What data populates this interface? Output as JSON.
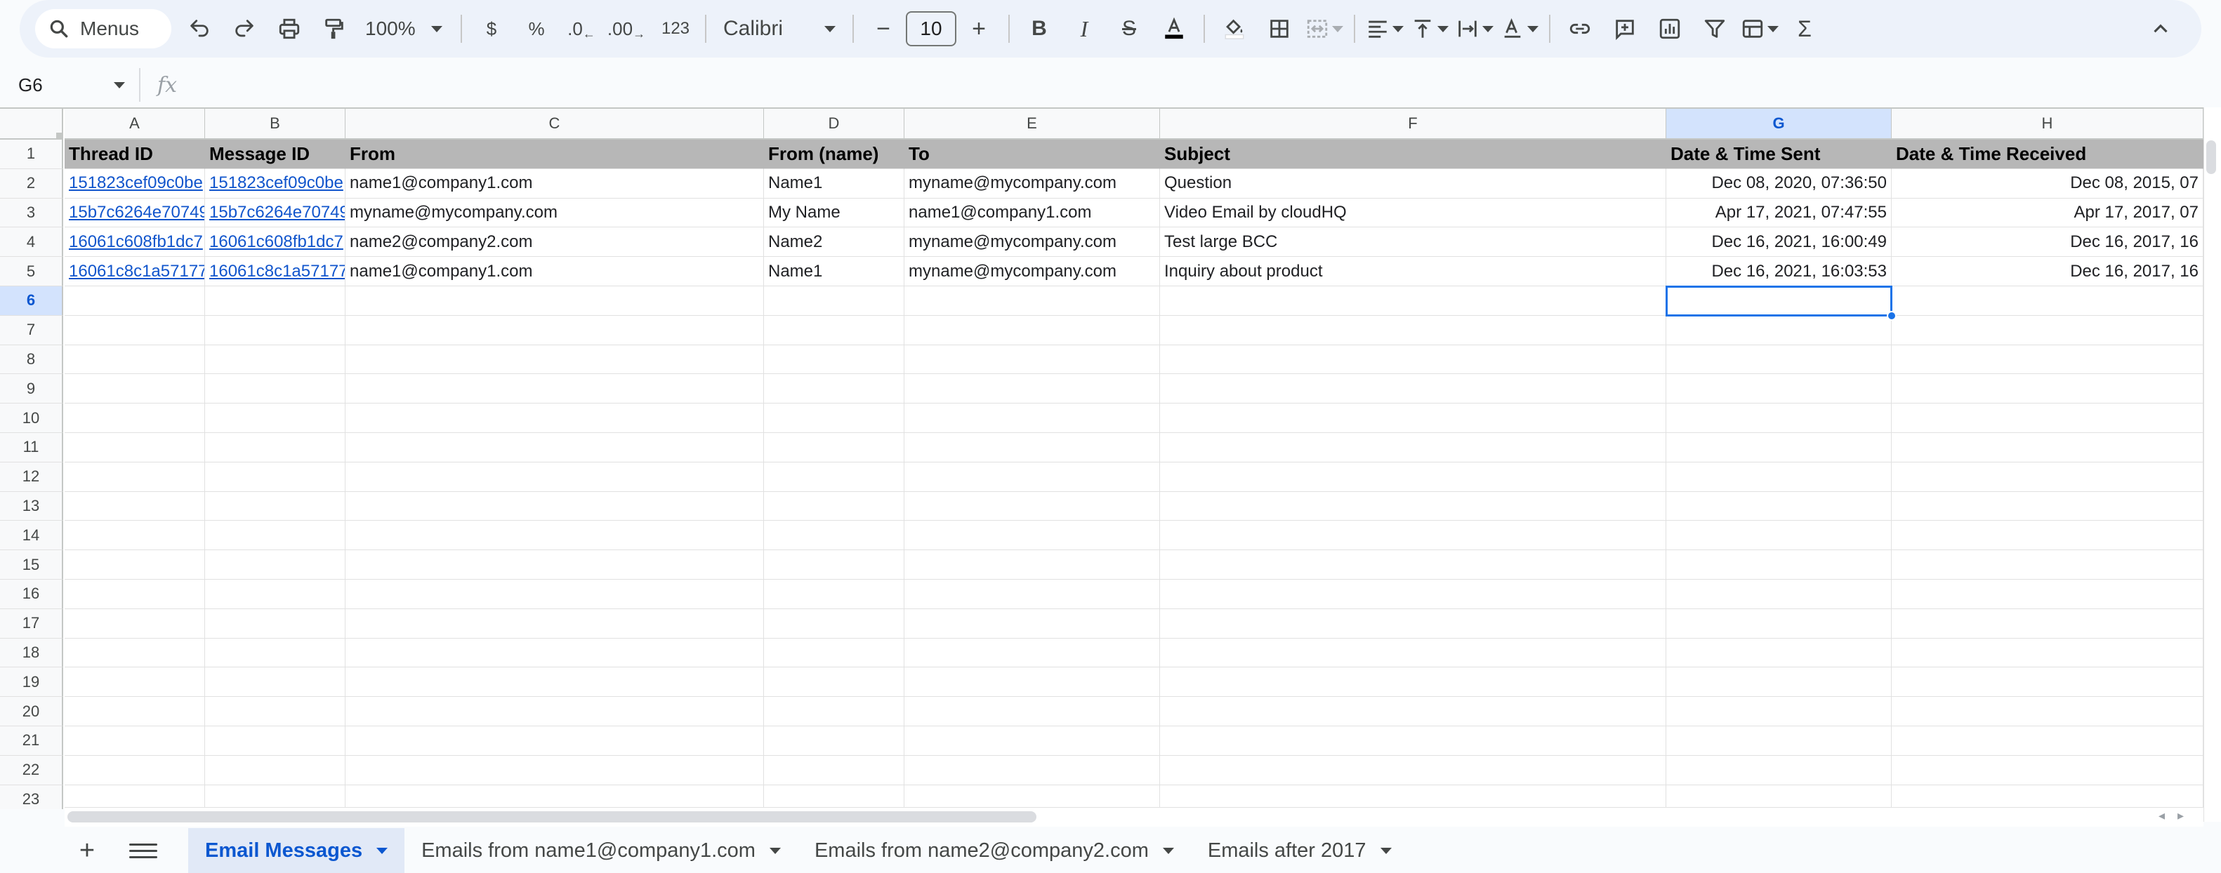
{
  "toolbar": {
    "search_label": "Menus",
    "zoom": "100%",
    "currency": "$",
    "percent": "%",
    "decrease_decimal": ".0",
    "increase_decimal": ".00",
    "number_format": "123",
    "font": "Calibri",
    "font_size": "10"
  },
  "formula_bar": {
    "cell_ref": "G6",
    "fx": "fx",
    "content": ""
  },
  "columns": [
    "A",
    "B",
    "C",
    "D",
    "E",
    "F",
    "G",
    "H"
  ],
  "selected_column": "G",
  "rows": [
    "1",
    "2",
    "3",
    "4",
    "5",
    "6",
    "7",
    "8",
    "9",
    "10",
    "11",
    "12",
    "13",
    "14",
    "15",
    "16",
    "17",
    "18",
    "19",
    "20",
    "21",
    "22",
    "23"
  ],
  "selected_row": "6",
  "headers": [
    "Thread ID",
    "Message ID",
    "From",
    "From (name)",
    "To",
    "Subject",
    "Date & Time Sent",
    "Date & Time Received"
  ],
  "data_rows": [
    [
      "151823cef09c0be",
      "151823cef09c0be",
      "name1@company1.com",
      "Name1",
      "myname@mycompany.com",
      "Question",
      "Dec 08, 2020, 07:36:50",
      "Dec 08, 2015, 07"
    ],
    [
      "15b7c6264e70749",
      "15b7c6264e70749",
      "myname@mycompany.com",
      "My Name",
      "name1@company1.com",
      "Video Email by cloudHQ",
      "Apr 17, 2021, 07:47:55",
      "Apr 17, 2017, 07"
    ],
    [
      "16061c608fb1dc7",
      "16061c608fb1dc7",
      "name2@company2.com",
      "Name2",
      "myname@mycompany.com",
      "Test large BCC",
      "Dec 16, 2021, 16:00:49",
      "Dec 16, 2017, 16"
    ],
    [
      "16061c8c1a57177",
      "16061c8c1a57177",
      "name1@company1.com",
      "Name1",
      "myname@mycompany.com",
      "Inquiry about product",
      "Dec 16, 2021, 16:03:53",
      "Dec 16, 2017, 16"
    ]
  ],
  "sheet_tabs": [
    {
      "label": "Email Messages",
      "active": true
    },
    {
      "label": "Emails from name1@company1.com",
      "active": false
    },
    {
      "label": "Emails from name2@company2.com",
      "active": false
    },
    {
      "label": "Emails after 2017",
      "active": false
    }
  ],
  "colors": {
    "header_fill": "#b7b7b7",
    "selection": "#1a73e8",
    "link": "#1155cc",
    "active_tab": "#0b57d0"
  }
}
